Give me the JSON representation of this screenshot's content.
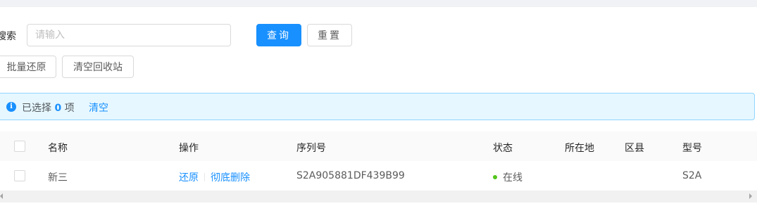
{
  "search": {
    "label": "搜索",
    "placeholder": "请输入",
    "value": ""
  },
  "buttons": {
    "query": "查询",
    "reset": "重置",
    "batch_restore": "批量还原",
    "empty_recycle_bin": "清空回收站"
  },
  "alert": {
    "prefix": "已选择",
    "count": "0",
    "suffix": "项",
    "clear": "清空",
    "icon": "info-circle-icon"
  },
  "table": {
    "columns": [
      "名称",
      "操作",
      "序列号",
      "状态",
      "所在地",
      "区县",
      "型号"
    ],
    "rows": [
      {
        "name": "新三",
        "actions": [
          "还原",
          "彻底删除"
        ],
        "serial": "S2A905881DF439B99",
        "status": "在线",
        "location": "",
        "district": "",
        "model": "S2A"
      }
    ]
  },
  "colors": {
    "primary": "#1890ff",
    "alert_bg": "#e6f7ff",
    "status_online": "#52c41a"
  }
}
